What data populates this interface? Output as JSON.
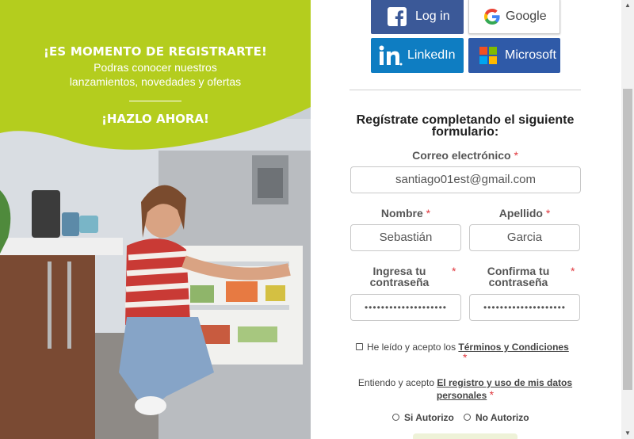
{
  "promo": {
    "headline": "¡ES MOMENTO DE REGISTRARTE!",
    "subline_1": "Podras conocer nuestros",
    "subline_2": "lanzamientos, novedades y ofertas",
    "cta": "¡HAZLO AHORA!",
    "accent_color": "#b4cd1e"
  },
  "social": {
    "facebook_label": "Log in",
    "google_label": "Google",
    "linkedin_label": "LinkedIn",
    "microsoft_label": "Microsoft"
  },
  "form": {
    "title_line_1": "Regístrate completando el siguiente",
    "title_line_2": "formulario:",
    "email_label": "Correo electrónico",
    "email_value": "santiago01est@gmail.com",
    "first_name_label": "Nombre",
    "first_name_value": "Sebastián",
    "last_name_label": "Apellido",
    "last_name_value": "Garcia",
    "password_label_1": "Ingresa tu",
    "password_label_2": "contraseña",
    "confirm_label_1": "Confirma tu",
    "confirm_label_2": "contraseña",
    "password_mask": "••••••••••••••••••••",
    "confirm_mask": "••••••••••••••••••••",
    "required_mark": "*",
    "terms_prefix": "He leído y acepto los",
    "terms_link": "Términos y Condiciones",
    "data_prefix": "Entiendo y acepto",
    "data_link_1": "El registro y uso de mis datos",
    "data_link_2": "personales",
    "opt_yes": "Si Autorizo",
    "opt_no": "No Autorizo"
  }
}
